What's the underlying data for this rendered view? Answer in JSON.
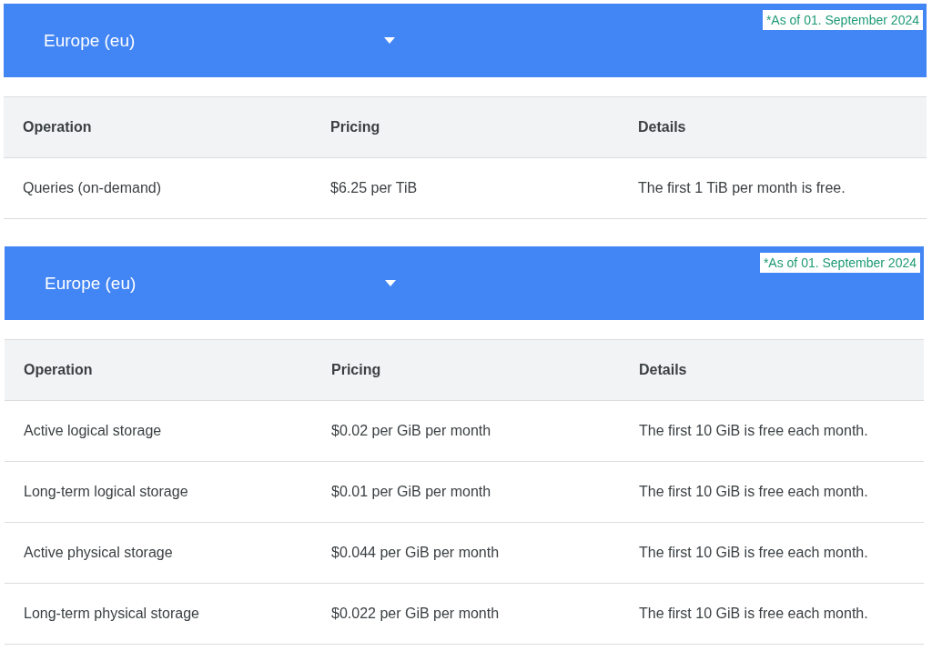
{
  "sections": [
    {
      "region": "Europe (eu)",
      "note": "*As of 01. September 2024",
      "columns": [
        "Operation",
        "Pricing",
        "Details"
      ],
      "rows": [
        [
          "Queries (on-demand)",
          "$6.25 per TiB",
          "The first 1 TiB per month is free."
        ]
      ]
    },
    {
      "region": "Europe (eu)",
      "note": "*As of 01. September 2024",
      "columns": [
        "Operation",
        "Pricing",
        "Details"
      ],
      "rows": [
        [
          "Active logical storage",
          "$0.02 per GiB per month",
          "The first 10 GiB is free each month."
        ],
        [
          "Long-term logical storage",
          "$0.01 per GiB per month",
          "The first 10 GiB is free each month."
        ],
        [
          "Active physical storage",
          "$0.044 per GiB per month",
          "The first 10 GiB is free each month."
        ],
        [
          "Long-term physical storage",
          "$0.022 per GiB per month",
          "The first 10 GiB is free each month."
        ]
      ]
    }
  ]
}
